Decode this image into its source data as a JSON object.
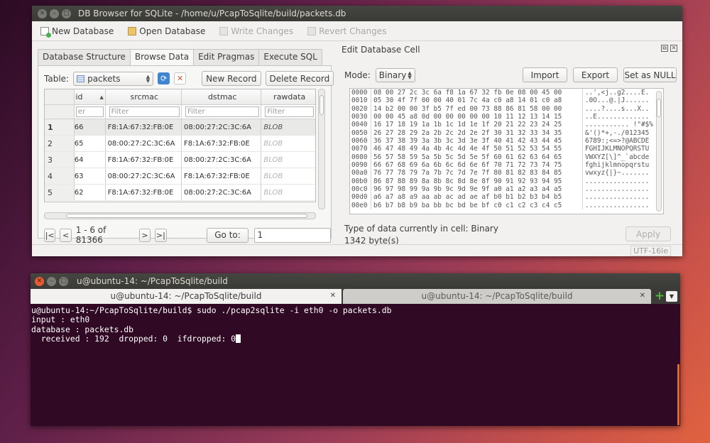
{
  "db_window": {
    "title": "DB Browser for SQLite - /home/u/PcapToSqlite/build/packets.db",
    "toolbar": {
      "new_database": "New Database",
      "open_database": "Open Database",
      "write_changes": "Write Changes",
      "revert_changes": "Revert Changes"
    },
    "tabs": [
      "Database Structure",
      "Browse Data",
      "Edit Pragmas",
      "Execute SQL"
    ],
    "active_tab": "Browse Data",
    "browse": {
      "table_label": "Table:",
      "table_selected": "packets",
      "new_record": "New Record",
      "delete_record": "Delete Record",
      "columns": [
        "id",
        "srcmac",
        "dstmac",
        "rawdata"
      ],
      "filter_placeholder": "Filter",
      "id_filter_visible": "er",
      "rows": [
        {
          "num": "1",
          "id": "66",
          "srcmac": "F8:1A:67:32:FB:0E",
          "dstmac": "08:00:27:2C:3C:6A",
          "rawdata": "BLOB"
        },
        {
          "num": "2",
          "id": "65",
          "srcmac": "08:00:27:2C:3C:6A",
          "dstmac": "F8:1A:67:32:FB:0E",
          "rawdata": "BLOB"
        },
        {
          "num": "3",
          "id": "64",
          "srcmac": "F8:1A:67:32:FB:0E",
          "dstmac": "08:00:27:2C:3C:6A",
          "rawdata": "BLOB"
        },
        {
          "num": "4",
          "id": "63",
          "srcmac": "08:00:27:2C:3C:6A",
          "dstmac": "F8:1A:67:32:FB:0E",
          "rawdata": "BLOB"
        },
        {
          "num": "5",
          "id": "62",
          "srcmac": "F8:1A:67:32:FB:0E",
          "dstmac": "08:00:27:2C:3C:6A",
          "rawdata": "BLOB"
        }
      ],
      "nav_first": "|<",
      "nav_prev": "<",
      "record_info": "1 - 6 of 81366",
      "nav_next": ">",
      "nav_last": ">|",
      "goto_label": "Go to:",
      "goto_value": "1"
    },
    "edit_cell": {
      "title": "Edit Database Cell",
      "mode_label": "Mode:",
      "mode_value": "Binary",
      "import": "Import",
      "export": "Export",
      "set_null": "Set as NULL",
      "hex_offsets": [
        "0000",
        "0010",
        "0020",
        "0030",
        "0040",
        "0050",
        "0060",
        "0070",
        "0080",
        "0090",
        "00a0",
        "00b0",
        "00c0",
        "00d0",
        "00e0"
      ],
      "hex_rows": [
        "08 00 27 2c 3c 6a f8 1a 67 32 fb 0e 08 00 45 00",
        "05 30 4f 7f 00 00 40 01 7c 4a c0 a8 14 01 c0 a8",
        "14 b2 00 00 3f b5 7f ed 00 73 88 86 81 58 00 00",
        "00 00 45 a8 0d 00 00 00 00 00 10 11 12 13 14 15",
        "16 17 18 19 1a 1b 1c 1d 1e 1f 20 21 22 23 24 25",
        "26 27 28 29 2a 2b 2c 2d 2e 2f 30 31 32 33 34 35",
        "36 37 38 39 3a 3b 3c 3d 3e 3f 40 41 42 43 44 45",
        "46 47 48 49 4a 4b 4c 4d 4e 4f 50 51 52 53 54 55",
        "56 57 58 59 5a 5b 5c 5d 5e 5f 60 61 62 63 64 65",
        "66 67 68 69 6a 6b 6c 6d 6e 6f 70 71 72 73 74 75",
        "76 77 78 79 7a 7b 7c 7d 7e 7f 80 81 82 83 84 85",
        "86 87 88 89 8a 8b 8c 8d 8e 8f 90 91 92 93 94 95",
        "96 97 98 99 9a 9b 9c 9d 9e 9f a0 a1 a2 a3 a4 a5",
        "a6 a7 a8 a9 aa ab ac ad ae af b0 b1 b2 b3 b4 b5",
        "b6 b7 b8 b9 ba bb bc bd be bf c0 c1 c2 c3 c4 c5"
      ],
      "ascii_rows": [
        "..',<j..g2....E.",
        ".0O...@.|J......",
        "....?....s...X..",
        "..E.............",
        "........... !\"#$%",
        "&'()*+,-./012345",
        "6789:;<=>?@ABCDE",
        "FGHIJKLMNOPQRSTU",
        "VWXYZ[\\]^_`abcde",
        "fghijklmnopqrstu",
        "vwxyz{|}~.......",
        "................",
        "................",
        "................",
        "................"
      ],
      "type_info": "Type of data currently in cell: Binary",
      "size_info": "1342 byte(s)",
      "apply": "Apply"
    },
    "status_encoding": "UTF-16le"
  },
  "terminal": {
    "title": "u@ubuntu-14: ~/PcapToSqlite/build",
    "tab1": "u@ubuntu-14: ~/PcapToSqlite/build",
    "tab2": "u@ubuntu-14: ~/PcapToSqlite/build",
    "lines": [
      "u@ubuntu-14:~/PcapToSqlite/build$ sudo ./pcap2sqlite -i eth0 -o packets.db",
      "input : eth0",
      "database : packets.db",
      "  received : 192  dropped: 0  ifdropped: 0"
    ]
  },
  "colors": {
    "terminal_bg": "#300a24",
    "titlebar": "#3c3b37",
    "close_button": "#e65a35",
    "refresh_icon": "#3f86cf",
    "terminal_scroll": "#e06a2c"
  }
}
